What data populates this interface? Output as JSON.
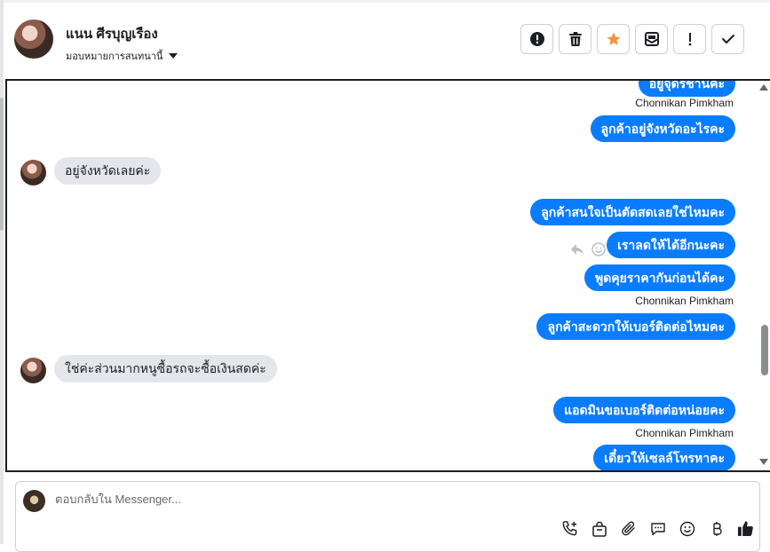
{
  "header": {
    "contact_name": "แนน ศีรบุญเรือง",
    "assign_label": "มอบหมายการสนทนานี้",
    "actions": [
      {
        "icon": "alert-circle-icon"
      },
      {
        "icon": "trash-icon"
      },
      {
        "icon": "star-icon"
      },
      {
        "icon": "mark-unread-icon"
      },
      {
        "icon": "exclamation-icon"
      },
      {
        "icon": "checkmark-icon"
      }
    ]
  },
  "messages": [
    {
      "direction": "out",
      "text": "อยู่จุดรชานคะ"
    },
    {
      "direction": "sender",
      "text": "Chonnikan Pimkham"
    },
    {
      "direction": "out",
      "text": "ลูกค้าอยู่จังหวัดอะไรคะ"
    },
    {
      "direction": "in",
      "text": "อยู่จังหวัดเลยค่ะ"
    },
    {
      "direction": "out",
      "text": "ลูกค้าสนใจเป็นตัดสดเลยใช่ไหมคะ"
    },
    {
      "direction": "out",
      "text": "เราลดให้ได้อีกนะคะ"
    },
    {
      "direction": "out",
      "text": "พูดคุยราคากันก่อนได้คะ"
    },
    {
      "direction": "sender",
      "text": "Chonnikan Pimkham"
    },
    {
      "direction": "out",
      "text": "ลูกค้าสะดวกให้เบอร์ติดต่อไหมคะ"
    },
    {
      "direction": "in",
      "text": "ใช่ค่ะส่วนมากหนูซื้อรถจะซื้อเงินสดค่ะ"
    },
    {
      "direction": "out",
      "text": "แอดมินขอเบอร์ติดต่อหน่อยคะ"
    },
    {
      "direction": "sender",
      "text": "Chonnikan Pimkham"
    },
    {
      "direction": "out",
      "text": "เดี๋ยวให้เซลล์โทรหาคะ"
    }
  ],
  "composer": {
    "placeholder": "ตอบกลับใน Messenger...",
    "tools": [
      "add-call-icon",
      "shopping-bag-icon",
      "paperclip-icon",
      "saved-reply-icon",
      "emoji-icon",
      "baht-icon",
      "thumbs-up-icon"
    ]
  },
  "colors": {
    "accent": "#0a7cff",
    "incoming_bubble": "#e4e6eb",
    "star": "#f7923b"
  }
}
